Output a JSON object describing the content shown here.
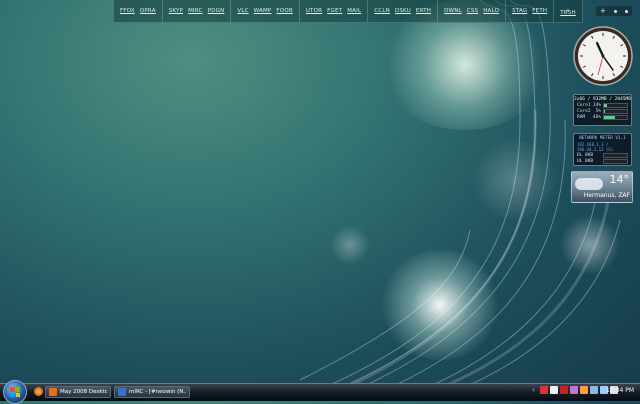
{
  "launcher": {
    "groups": [
      [
        "FFOX",
        "OPRA"
      ],
      [
        "SKYP",
        "MIRC",
        "PDGN"
      ],
      [
        "VLC",
        "WAMP",
        "FOOB"
      ],
      [
        "UTOR",
        "FGET",
        "MAIL"
      ],
      [
        "CCLN",
        "DSKU",
        "ERTH"
      ],
      [
        "DWNL",
        "CSS",
        "HALO"
      ],
      [
        "STAG",
        "FETH"
      ]
    ],
    "trash_label": "TRSH"
  },
  "sidebar": {
    "toolbar": {
      "add_label": "+"
    },
    "cpu": {
      "header": "2x66 / 932MB / 2045MB",
      "rows": [
        {
          "label": "Core1",
          "value": "14%",
          "percent": 14
        },
        {
          "label": "Core2",
          "value": "5%",
          "percent": 5
        },
        {
          "label": "RAM",
          "value": "46%",
          "percent": 46
        }
      ]
    },
    "network": {
      "header": "NETWORK METER V1.1",
      "ip": "192.168.1.3 / 196.44.2.12 (S)",
      "rows": [
        {
          "label": "DL",
          "value": "0KB"
        },
        {
          "label": "UL",
          "value": "0KB"
        }
      ]
    },
    "weather": {
      "temp": "14°",
      "city": "Hermanus, ZAF"
    }
  },
  "taskbar": {
    "tasks": [
      {
        "label": "May 2008 Desktops ...",
        "color": "#e86a1a"
      },
      {
        "label": "mIRC - [#neowin (N...",
        "color": "#3a6fd0"
      }
    ],
    "time": "10:34 PM"
  },
  "colors": {
    "accent": "#5fd07a",
    "tray_icons": [
      "#d33",
      "#eee",
      "#c22",
      "#b7c",
      "#f94",
      "#8bd",
      "#9cf",
      "#ddd",
      "#bbb"
    ]
  }
}
